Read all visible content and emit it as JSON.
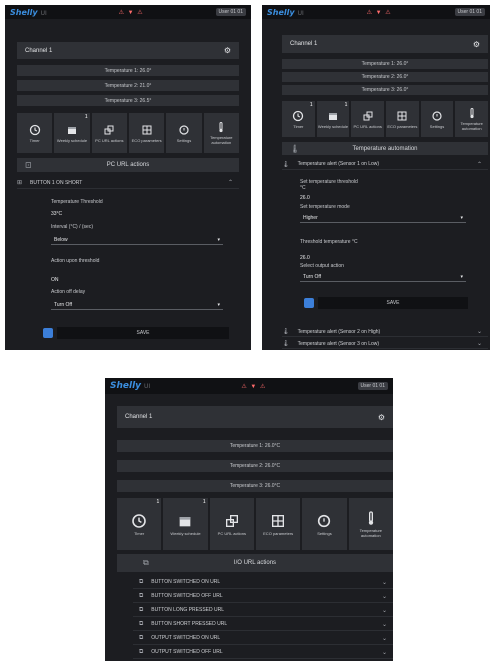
{
  "app": {
    "logo": "Shelly",
    "logo_suffix": "UI",
    "status_icons": "⚠ ▼ ⚠",
    "user_chip": "User 01 01"
  },
  "panel_left": {
    "device": "Channel 1",
    "temps": [
      "Temperature 1: 26.0°",
      "Temperature 2: 21.0°",
      "Temperature 3: 26.5°"
    ],
    "tiles": [
      {
        "label": "Timer",
        "badge": ""
      },
      {
        "label": "Weekly schedule",
        "badge": "1"
      },
      {
        "label": "PC URL actions",
        "badge": ""
      },
      {
        "label": "ECO parameters",
        "badge": ""
      },
      {
        "label": "Settings",
        "badge": ""
      },
      {
        "label": "Temperature automation",
        "badge": ""
      }
    ],
    "section": "PC URL actions",
    "accordion_title": "BUTTON 1 ON SHORT",
    "field1_label": "Temperature Threshold",
    "field1_value": "33°C",
    "field2_label": "Interval (°C) / (sec)",
    "select1": "Below",
    "field3_label": "Action upon threshold",
    "field3_value": "ON",
    "field4_label": "Action off delay",
    "select2": "Turn Off",
    "save": "SAVE"
  },
  "panel_right": {
    "device": "Channel 1",
    "temps": [
      "Temperature 1: 26.0°",
      "Temperature 2: 26.0°",
      "Temperature 3: 26.0°"
    ],
    "tiles": [
      {
        "label": "Timer",
        "badge": "1"
      },
      {
        "label": "Weekly schedule",
        "badge": "1"
      },
      {
        "label": "PC URL actions",
        "badge": ""
      },
      {
        "label": "ECO parameters",
        "badge": ""
      },
      {
        "label": "Settings",
        "badge": ""
      },
      {
        "label": "Temperature automation",
        "badge": ""
      }
    ],
    "section": "Temperature automation",
    "accordion_title": "Temperature alert (Sensor 1 on Low)",
    "field1_label": "Set temperature threshold °C",
    "field1_value": "26.0",
    "field2_label": "Set temperature mode",
    "select1": "Higher",
    "field3_label": "Threshold temperature °C",
    "field3_value": "26.0",
    "field4_label": "Select output action",
    "select2": "Turn Off",
    "save": "SAVE",
    "extra_rows": [
      "Temperature alert (Sensor 2 on High)",
      "Temperature alert (Sensor 3 on Low)"
    ]
  },
  "panel_bottom": {
    "device": "Channel 1",
    "temps": [
      "Temperature 1: 26.0°C",
      "Temperature 2: 26.0°C",
      "Temperature 3: 26.0°C"
    ],
    "tiles": [
      {
        "label": "Timer",
        "badge": "1"
      },
      {
        "label": "Weekly schedule",
        "badge": "1"
      },
      {
        "label": "PC URL actions",
        "badge": ""
      },
      {
        "label": "ECO parameters",
        "badge": ""
      },
      {
        "label": "Settings",
        "badge": ""
      },
      {
        "label": "Temperature automation",
        "badge": ""
      }
    ],
    "section": "I/O URL actions",
    "rows": [
      "BUTTON SWITCHED ON URL",
      "BUTTON SWITCHED OFF URL",
      "BUTTON LONG PRESSED URL",
      "BUTTON SHORT PRESSED URL",
      "OUTPUT SWITCHED ON URL",
      "OUTPUT SWITCHED OFF URL"
    ]
  }
}
